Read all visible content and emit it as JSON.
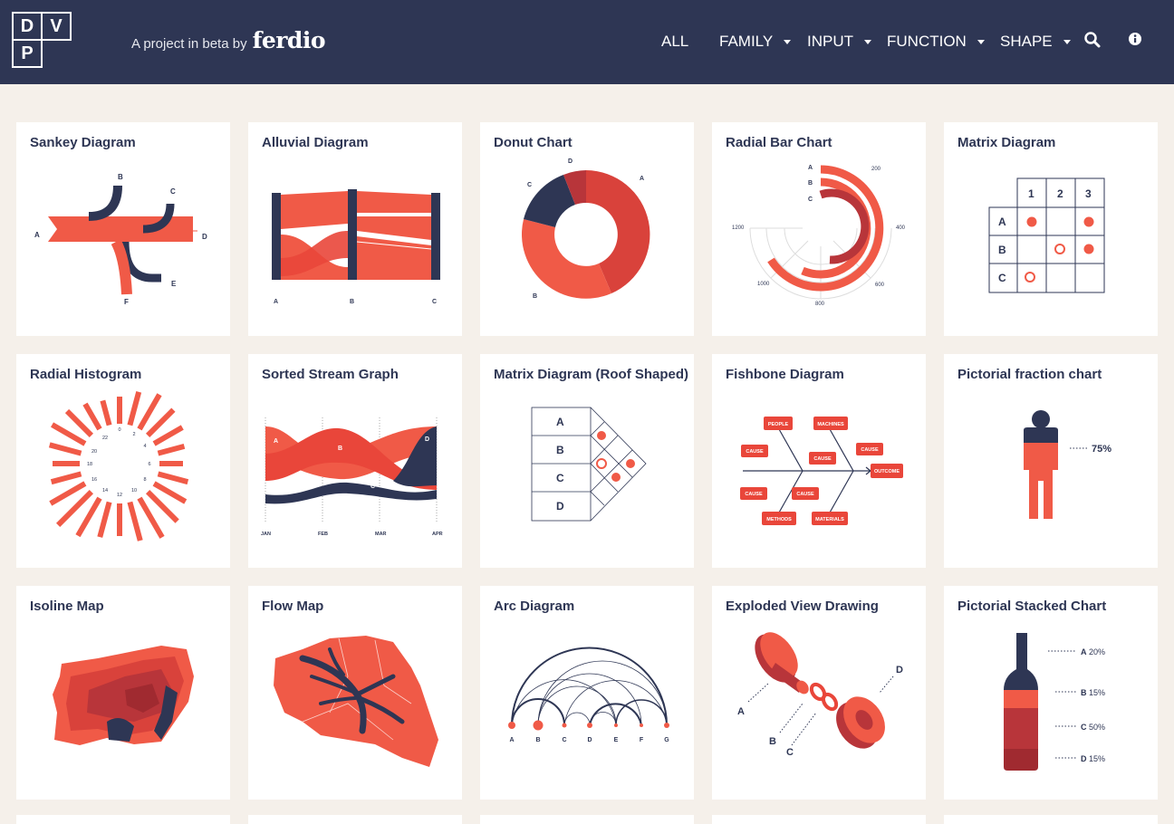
{
  "logo": {
    "letters": [
      "D",
      "V",
      "P"
    ]
  },
  "tagline": {
    "prefix": "A project in beta by",
    "brand": "ferdio"
  },
  "nav": {
    "items": [
      {
        "label": "ALL",
        "has_dropdown": false
      },
      {
        "label": "FAMILY",
        "has_dropdown": true
      },
      {
        "label": "INPUT",
        "has_dropdown": true
      },
      {
        "label": "FUNCTION",
        "has_dropdown": true
      },
      {
        "label": "SHAPE",
        "has_dropdown": true
      }
    ],
    "icons": [
      "search-icon",
      "info-icon"
    ]
  },
  "colors": {
    "header": "#2e3654",
    "accent": "#f05a47",
    "accent_dark": "#b8353a",
    "navy": "#2e3654",
    "background": "#f5f0ea"
  },
  "cards": [
    {
      "title": "Sankey Diagram",
      "labels": [
        "A",
        "B",
        "C",
        "D",
        "E",
        "F"
      ]
    },
    {
      "title": "Alluvial Diagram",
      "labels": [
        "A",
        "B",
        "C"
      ]
    },
    {
      "title": "Donut Chart",
      "labels": [
        "A",
        "B",
        "C",
        "D"
      ]
    },
    {
      "title": "Radial Bar Chart",
      "labels": [
        "A",
        "B",
        "C",
        "200",
        "400",
        "600",
        "800",
        "1000",
        "1200"
      ]
    },
    {
      "title": "Matrix Diagram",
      "labels": [
        "1",
        "2",
        "3",
        "A",
        "B",
        "C"
      ]
    },
    {
      "title": "Radial Histogram",
      "labels": [
        "0",
        "2",
        "4",
        "6",
        "8",
        "10",
        "12",
        "14",
        "16",
        "18",
        "20",
        "22"
      ]
    },
    {
      "title": "Sorted Stream Graph",
      "labels": [
        "A",
        "B",
        "C",
        "D",
        "JAN",
        "FEB",
        "MAR",
        "APR"
      ]
    },
    {
      "title": "Matrix Diagram (Roof Shaped)",
      "labels": [
        "A",
        "B",
        "C",
        "D"
      ]
    },
    {
      "title": "Fishbone Diagram",
      "labels": [
        "PEOPLE",
        "MACHINES",
        "CAUSE",
        "CAUSE",
        "CAUSE",
        "OUTCOME",
        "CAUSE",
        "CAUSE",
        "METHODS",
        "MATERIALS"
      ]
    },
    {
      "title": "Pictorial fraction chart",
      "labels": [
        "75%"
      ]
    },
    {
      "title": "Isoline Map",
      "labels": []
    },
    {
      "title": "Flow Map",
      "labels": []
    },
    {
      "title": "Arc Diagram",
      "labels": [
        "A",
        "B",
        "C",
        "D",
        "E",
        "F",
        "G"
      ]
    },
    {
      "title": "Exploded View Drawing",
      "labels": [
        "A",
        "B",
        "C",
        "D"
      ]
    },
    {
      "title": "Pictorial Stacked Chart",
      "labels": [
        "A",
        "20%",
        "B",
        "15%",
        "C",
        "50%",
        "D",
        "15%"
      ]
    }
  ]
}
